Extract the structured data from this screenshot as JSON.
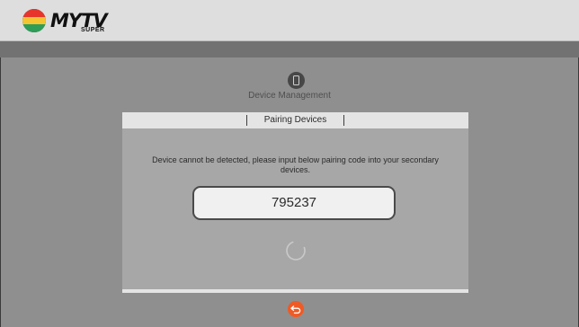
{
  "header": {
    "logo_text": "MYTV",
    "logo_sub": "SUPER"
  },
  "section": {
    "icon": "phone-icon",
    "title": "Device Management"
  },
  "panel": {
    "tab_label": "Pairing Devices",
    "message": "Device cannot be detected, please input below pairing code into your secondary devices.",
    "pairing_code": "795237",
    "loading_icon": "spinner-icon"
  },
  "footer": {
    "back_icon": "back-arrow-icon"
  },
  "colors": {
    "background": "#8f8f8f",
    "topbar": "#dedede",
    "panel": "#a7a7a7",
    "accent": "#f05a24"
  }
}
